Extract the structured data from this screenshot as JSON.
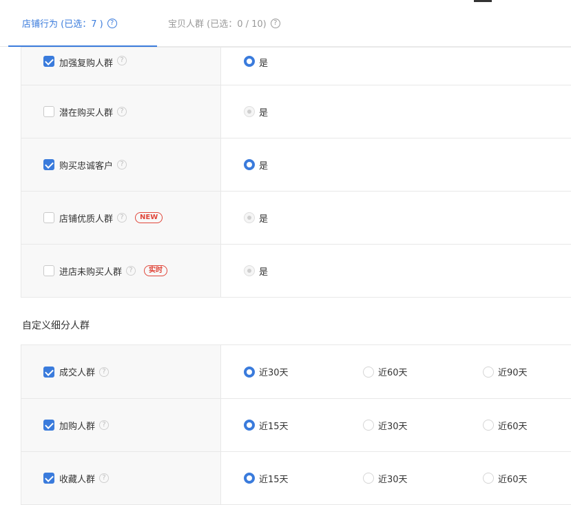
{
  "tabs": [
    {
      "label": "店铺行为 (已选：7 )",
      "active": true
    },
    {
      "label": "宝贝人群 (已选：0 / 10)",
      "active": false
    }
  ],
  "colors": {
    "accent": "#3a7bdc",
    "badge": "#e0463a",
    "border": "#e8e8e8",
    "cell_bg": "#f8f8f8"
  },
  "help_glyph": "?",
  "store_rows": [
    {
      "label": "加强复购人群",
      "checked": true,
      "badge": "",
      "option": "是",
      "selected": true
    },
    {
      "label": "潜在购买人群",
      "checked": false,
      "badge": "",
      "option": "是",
      "selected": false
    },
    {
      "label": "购买忠诚客户",
      "checked": true,
      "badge": "",
      "option": "是",
      "selected": true
    },
    {
      "label": "店铺优质人群",
      "checked": false,
      "badge": "NEW",
      "option": "是",
      "selected": false
    },
    {
      "label": "进店未购买人群",
      "checked": false,
      "badge": "实时",
      "option": "是",
      "selected": false
    }
  ],
  "custom_section_title": "自定义细分人群",
  "custom_rows": [
    {
      "label": "成交人群",
      "checked": true,
      "options": [
        "近30天",
        "近60天",
        "近90天"
      ],
      "selected": 0
    },
    {
      "label": "加购人群",
      "checked": true,
      "options": [
        "近15天",
        "近30天",
        "近60天"
      ],
      "selected": 0
    },
    {
      "label": "收藏人群",
      "checked": true,
      "options": [
        "近15天",
        "近30天",
        "近60天"
      ],
      "selected": 0
    }
  ]
}
